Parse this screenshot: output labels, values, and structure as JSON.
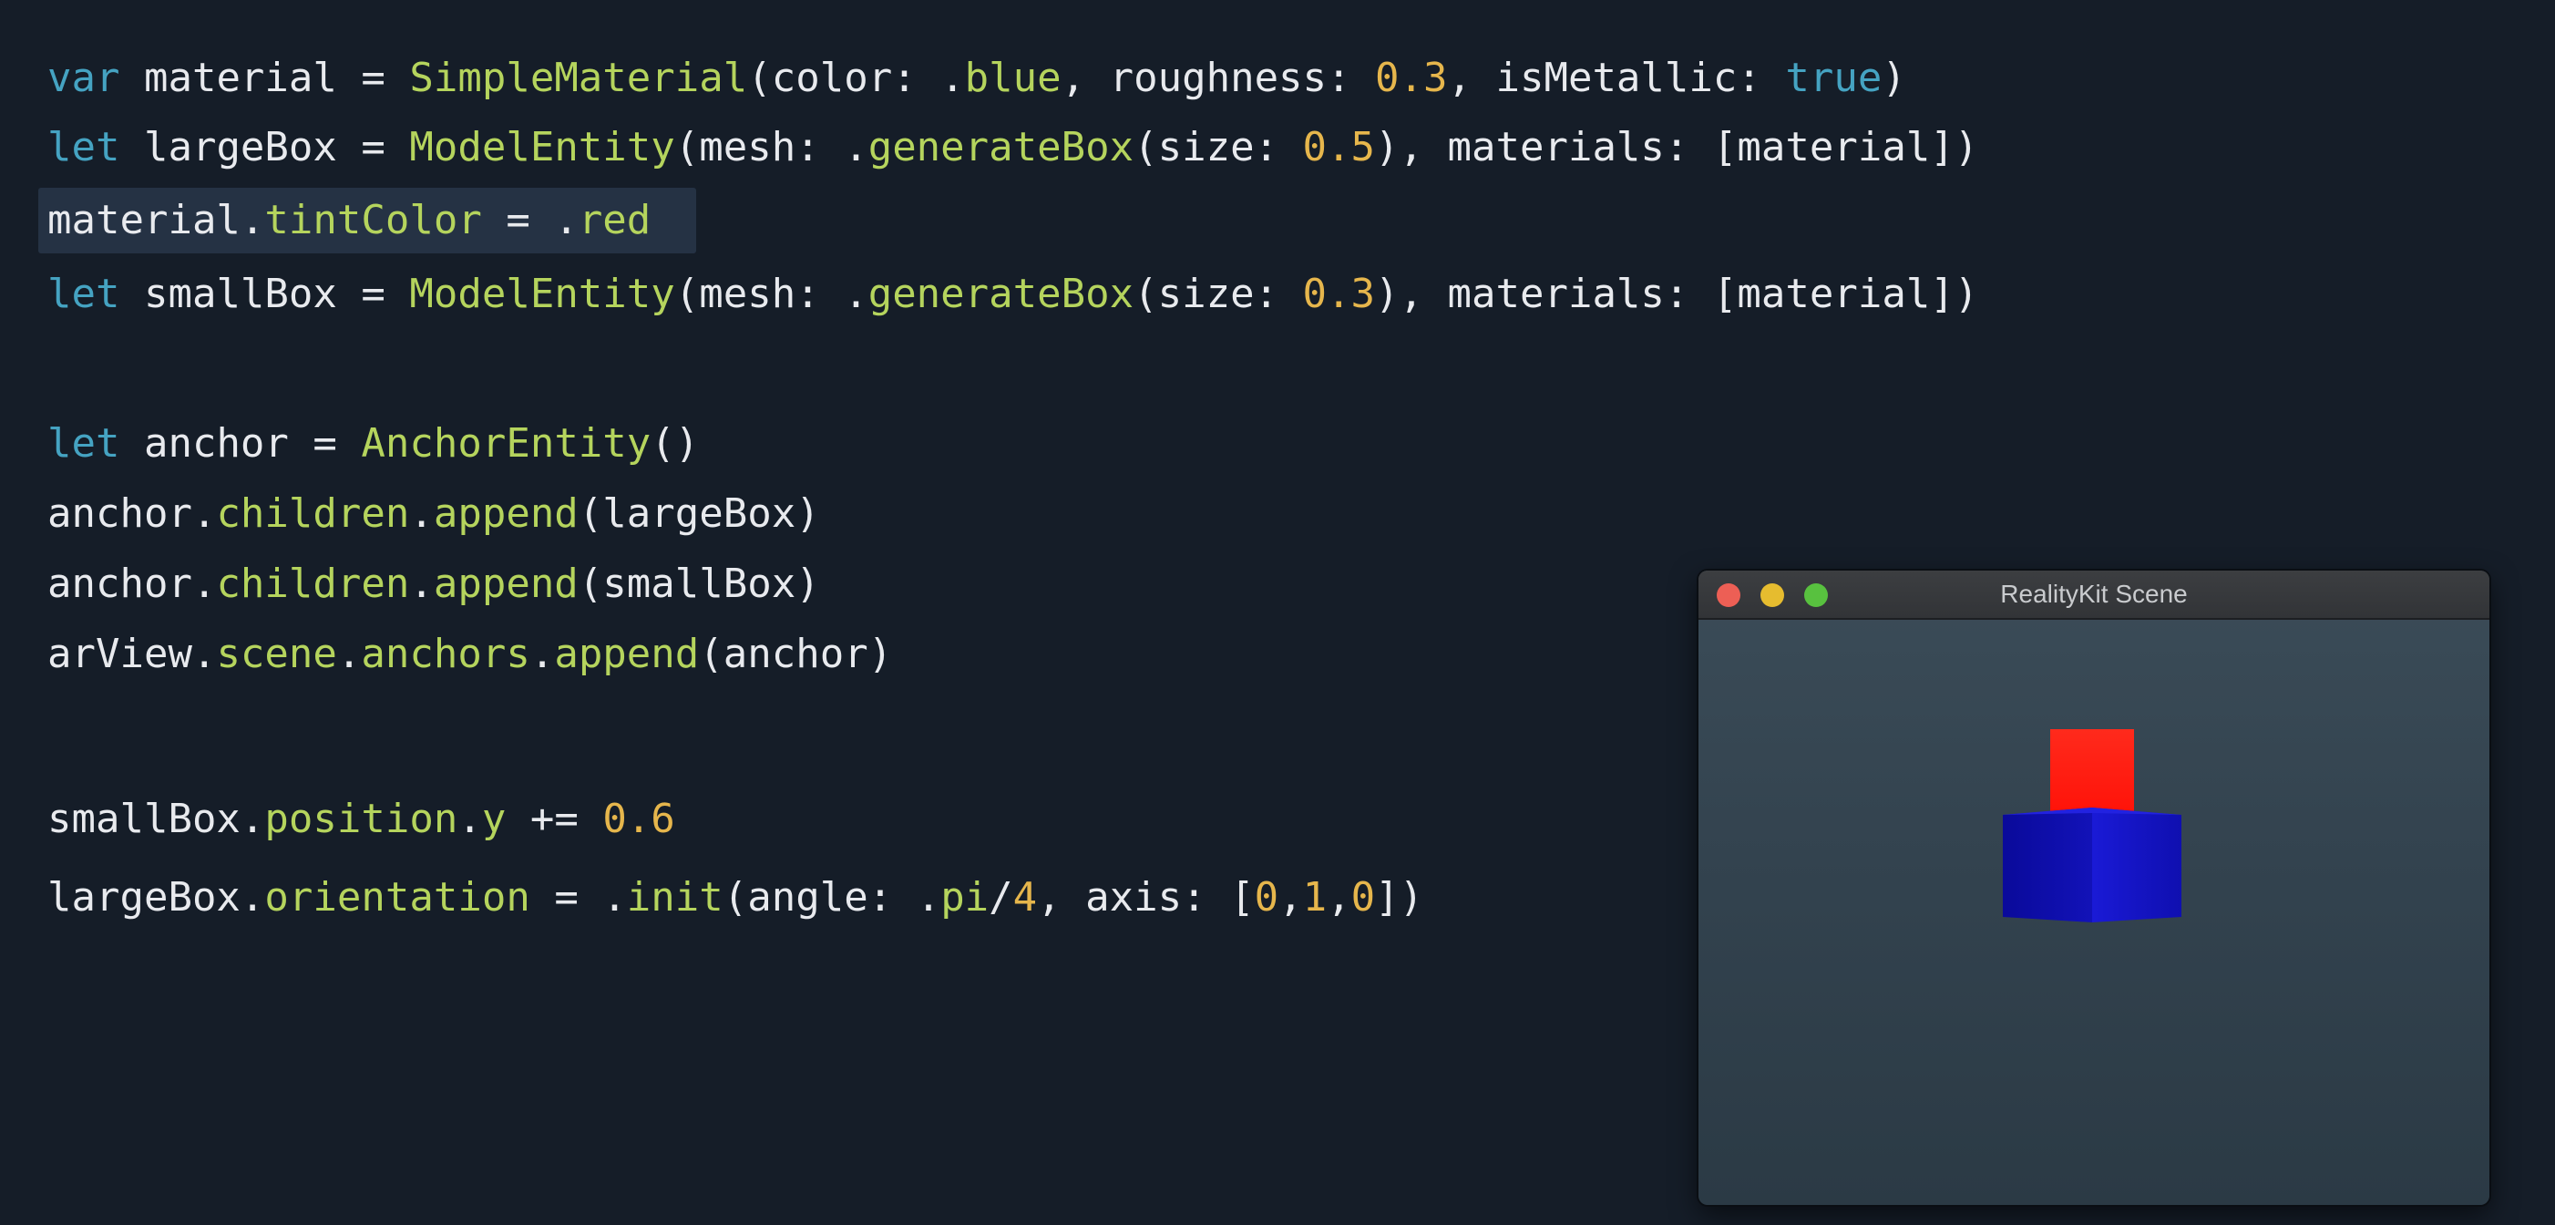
{
  "code": {
    "highlighted_line_index": 2,
    "lines": [
      [
        {
          "t": "var",
          "c": "kw"
        },
        {
          "t": " material = ",
          "c": "tx"
        },
        {
          "t": "SimpleMaterial",
          "c": "fn"
        },
        {
          "t": "(color: .",
          "c": "tx"
        },
        {
          "t": "blue",
          "c": "fn"
        },
        {
          "t": ", roughness: ",
          "c": "tx"
        },
        {
          "t": "0.3",
          "c": "num"
        },
        {
          "t": ", isMetallic: ",
          "c": "tx"
        },
        {
          "t": "true",
          "c": "kw"
        },
        {
          "t": ")",
          "c": "tx"
        }
      ],
      [
        {
          "t": "let",
          "c": "kw"
        },
        {
          "t": " largeBox = ",
          "c": "tx"
        },
        {
          "t": "ModelEntity",
          "c": "fn"
        },
        {
          "t": "(mesh: .",
          "c": "tx"
        },
        {
          "t": "generateBox",
          "c": "fn"
        },
        {
          "t": "(size: ",
          "c": "tx"
        },
        {
          "t": "0.5",
          "c": "num"
        },
        {
          "t": "), materials: [material])",
          "c": "tx"
        }
      ],
      [
        {
          "t": "material.",
          "c": "tx"
        },
        {
          "t": "tintColor",
          "c": "fn"
        },
        {
          "t": " = .",
          "c": "tx"
        },
        {
          "t": "red",
          "c": "fn"
        }
      ],
      [
        {
          "t": "let",
          "c": "kw"
        },
        {
          "t": " smallBox = ",
          "c": "tx"
        },
        {
          "t": "ModelEntity",
          "c": "fn"
        },
        {
          "t": "(mesh: .",
          "c": "tx"
        },
        {
          "t": "generateBox",
          "c": "fn"
        },
        {
          "t": "(size: ",
          "c": "tx"
        },
        {
          "t": "0.3",
          "c": "num"
        },
        {
          "t": "), materials: [material])",
          "c": "tx"
        }
      ],
      [
        {
          "t": "let",
          "c": "kw"
        },
        {
          "t": " anchor = ",
          "c": "tx"
        },
        {
          "t": "AnchorEntity",
          "c": "fn"
        },
        {
          "t": "()",
          "c": "tx"
        }
      ],
      [
        {
          "t": "anchor.",
          "c": "tx"
        },
        {
          "t": "children",
          "c": "fn"
        },
        {
          "t": ".",
          "c": "tx"
        },
        {
          "t": "append",
          "c": "fn"
        },
        {
          "t": "(largeBox)",
          "c": "tx"
        }
      ],
      [
        {
          "t": "anchor.",
          "c": "tx"
        },
        {
          "t": "children",
          "c": "fn"
        },
        {
          "t": ".",
          "c": "tx"
        },
        {
          "t": "append",
          "c": "fn"
        },
        {
          "t": "(smallBox)",
          "c": "tx"
        }
      ],
      [
        {
          "t": "arView.",
          "c": "tx"
        },
        {
          "t": "scene",
          "c": "fn"
        },
        {
          "t": ".",
          "c": "tx"
        },
        {
          "t": "anchors",
          "c": "fn"
        },
        {
          "t": ".",
          "c": "tx"
        },
        {
          "t": "append",
          "c": "fn"
        },
        {
          "t": "(anchor)",
          "c": "tx"
        }
      ],
      [
        {
          "t": "smallBox.",
          "c": "tx"
        },
        {
          "t": "position",
          "c": "fn"
        },
        {
          "t": ".",
          "c": "tx"
        },
        {
          "t": "y",
          "c": "fn"
        },
        {
          "t": " += ",
          "c": "tx"
        },
        {
          "t": "0.6",
          "c": "num"
        }
      ],
      [
        {
          "t": "largeBox.",
          "c": "tx"
        },
        {
          "t": "orientation",
          "c": "fn"
        },
        {
          "t": " = .",
          "c": "tx"
        },
        {
          "t": "init",
          "c": "fn"
        },
        {
          "t": "(angle: .",
          "c": "tx"
        },
        {
          "t": "pi",
          "c": "fn"
        },
        {
          "t": "/",
          "c": "tx"
        },
        {
          "t": "4",
          "c": "num"
        },
        {
          "t": ", axis: [",
          "c": "tx"
        },
        {
          "t": "0",
          "c": "num"
        },
        {
          "t": ",",
          "c": "tx"
        },
        {
          "t": "1",
          "c": "num"
        },
        {
          "t": ",",
          "c": "tx"
        },
        {
          "t": "0",
          "c": "num"
        },
        {
          "t": "])",
          "c": "tx"
        }
      ]
    ]
  },
  "window": {
    "title": "RealityKit Scene",
    "buttons": [
      "close-icon",
      "minimize-icon",
      "maximize-icon"
    ],
    "scene": {
      "small_box_color": "#ff1a12",
      "large_box_color": "#1010c8"
    }
  },
  "colors": {
    "background": "#151d28",
    "keyword": "#45a3c2",
    "function": "#b5d45d",
    "number": "#e6b64c",
    "text": "#e8eaee",
    "highlight": "#253244"
  }
}
